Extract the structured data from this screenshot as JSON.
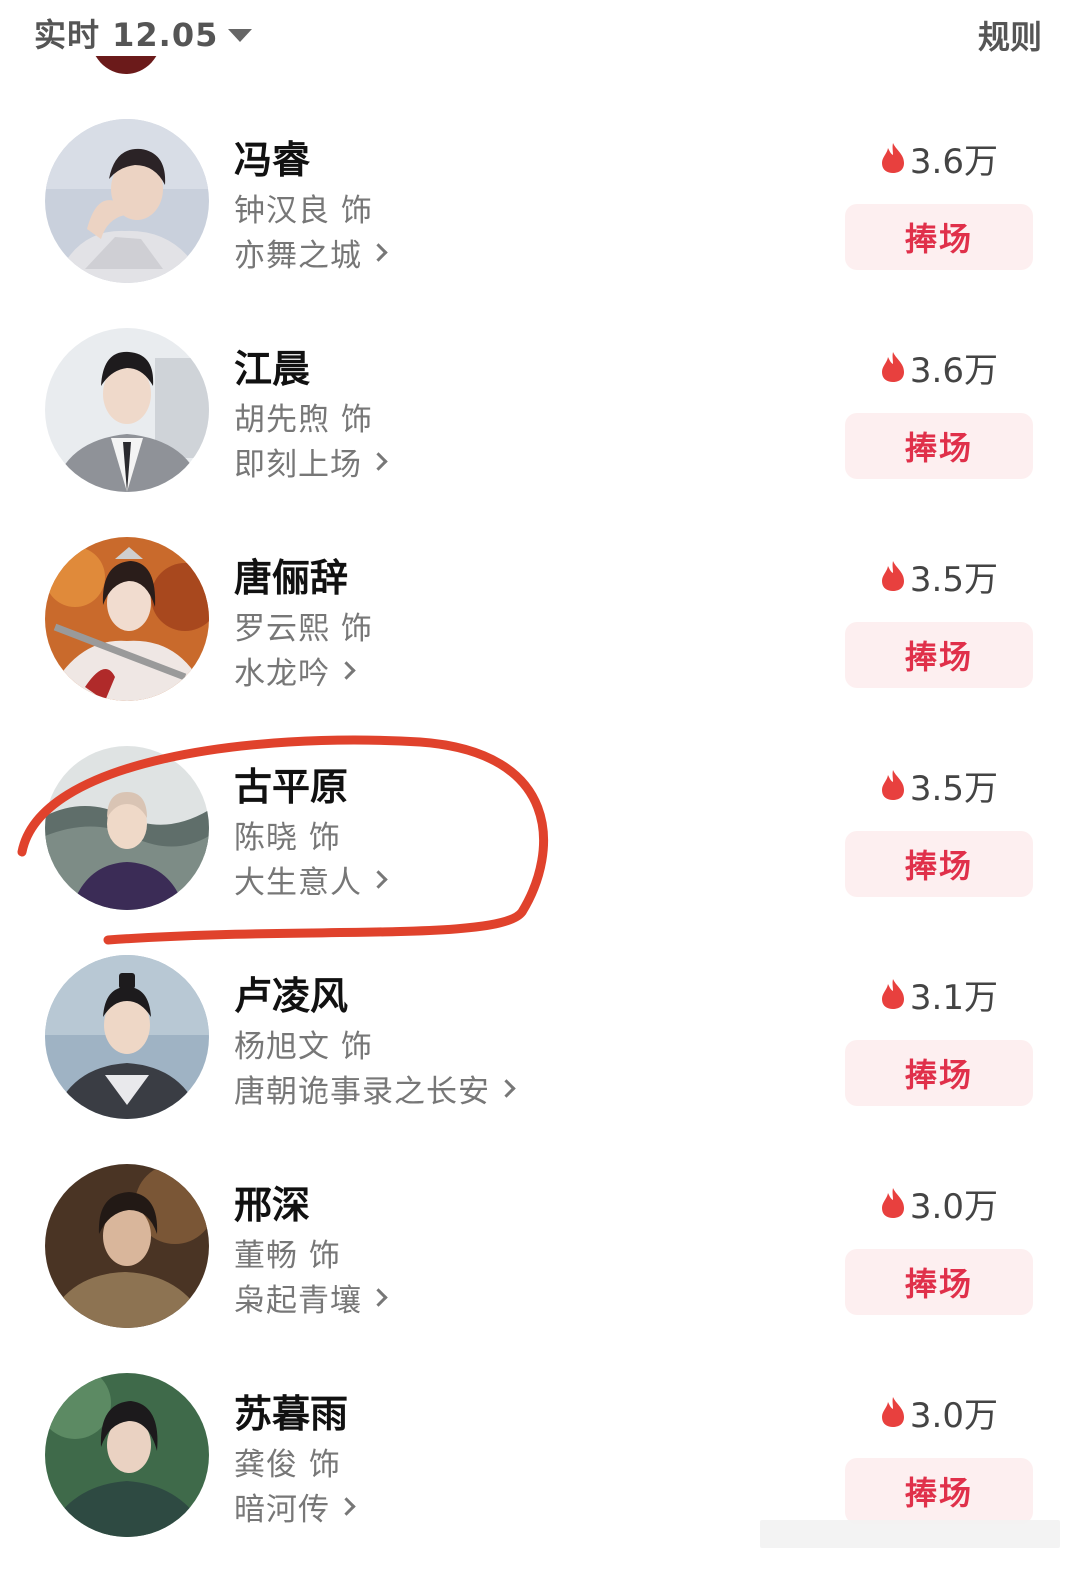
{
  "header": {
    "time_filter": "实时 12.05",
    "rules": "规则"
  },
  "colors": {
    "accent": "#e0304a",
    "button_bg": "#fdeff0",
    "flame": "#e8403e",
    "annotation": "#e0422c"
  },
  "icons": {
    "flame": "flame-icon",
    "dropdown": "caret-down-icon",
    "chevron": "chevron-right-icon"
  },
  "rows": [
    {
      "name": "冯睿",
      "role": "钟汉良 饰",
      "drama": "亦舞之城",
      "heat": "3.6万",
      "button": "捧场"
    },
    {
      "name": "江晨",
      "role": "胡先煦 饰",
      "drama": "即刻上场",
      "heat": "3.6万",
      "button": "捧场"
    },
    {
      "name": "唐俪辞",
      "role": "罗云熙 饰",
      "drama": "水龙吟",
      "heat": "3.5万",
      "button": "捧场"
    },
    {
      "name": "古平原",
      "role": "陈晓 饰",
      "drama": "大生意人",
      "heat": "3.5万",
      "button": "捧场"
    },
    {
      "name": "卢凌风",
      "role": "杨旭文 饰",
      "drama": "唐朝诡事录之长安",
      "heat": "3.1万",
      "button": "捧场"
    },
    {
      "name": "邢深",
      "role": "董畅 饰",
      "drama": "枭起青壤",
      "heat": "3.0万",
      "button": "捧场"
    },
    {
      "name": "苏暮雨",
      "role": "龚俊 饰",
      "drama": "暗河传",
      "heat": "3.0万",
      "button": "捧场"
    }
  ]
}
